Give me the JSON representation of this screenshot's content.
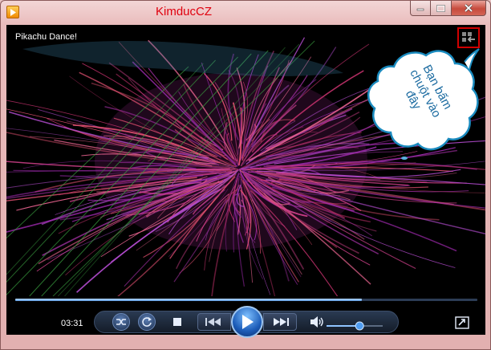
{
  "window": {
    "title": "KimducCZ",
    "title_color": "#e0000e"
  },
  "media": {
    "title": "Pikachu Dance!"
  },
  "callout": {
    "text": "Bạn bấm chuột vào đây",
    "fill": "#ffffff",
    "stroke": "#1a8bbf"
  },
  "player": {
    "elapsed": "03:31",
    "progress": 0.75,
    "volume": 0.6
  },
  "icons": {
    "app": "media-player-icon",
    "minimize": "minimize-icon",
    "maximize": "maximize-icon",
    "close": "close-icon",
    "switch_view": "switch-to-library-icon",
    "shuffle": "shuffle-icon",
    "repeat": "repeat-icon",
    "stop": "stop-icon",
    "previous": "previous-icon",
    "play": "play-icon",
    "next": "next-icon",
    "mute": "speaker-icon",
    "fullscreen": "fullscreen-icon"
  },
  "accent": "#3b8de8"
}
